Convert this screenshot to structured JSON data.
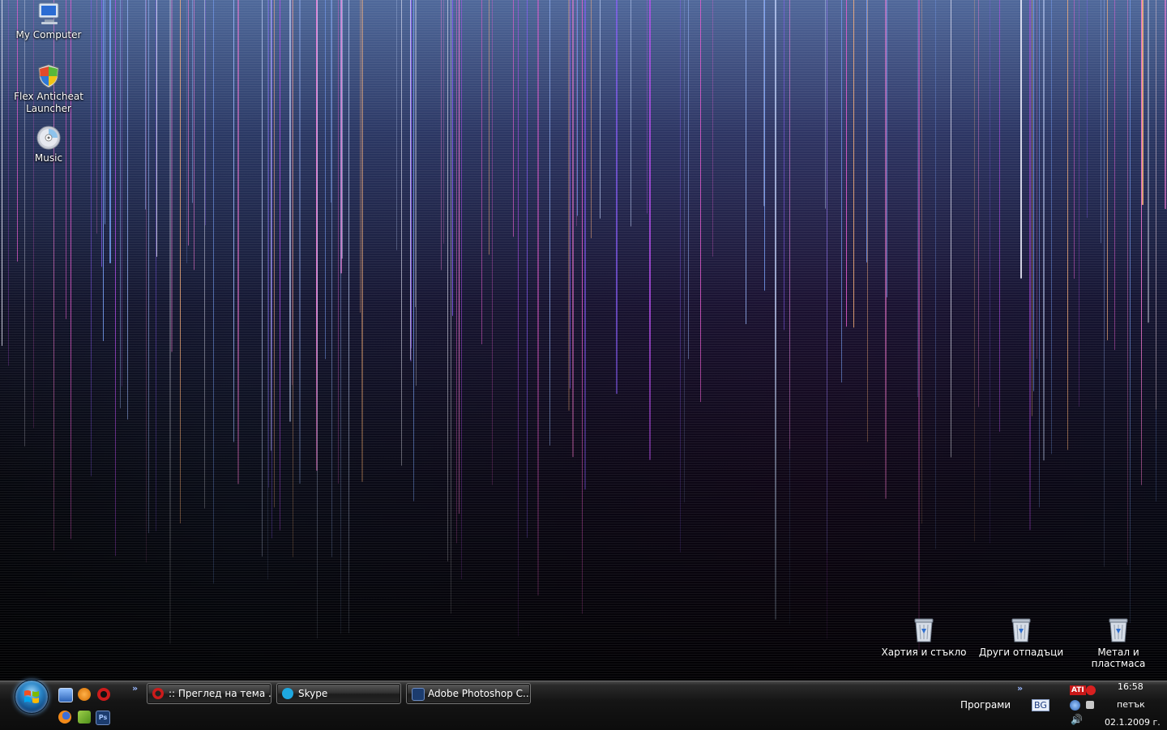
{
  "desktop": {
    "icons": [
      {
        "label_line1": "My Computer",
        "label_line2": "",
        "icon": "my-computer-icon"
      },
      {
        "label_line1": "Flex Anticheat",
        "label_line2": "Launcher",
        "icon": "shield-icon"
      },
      {
        "label_line1": "Music",
        "label_line2": "",
        "icon": "cd-icon"
      }
    ],
    "bins": [
      {
        "label": "Хартия и стъкло",
        "icon": "recycle-bin-icon"
      },
      {
        "label": "Други отпадъци",
        "icon": "recycle-bin-icon"
      },
      {
        "label": "Метал и пластмаса",
        "icon": "recycle-bin-icon"
      }
    ]
  },
  "taskbar": {
    "quicklaunch_chevron": "»",
    "tasks": [
      {
        "label": ":: Преглед на тема ...",
        "icon": "opera-icon"
      },
      {
        "label": "Skype",
        "icon": "skype-icon"
      },
      {
        "label": "Adobe Photoshop C...",
        "icon": "photoshop-icon"
      }
    ],
    "toolbar_chevron": "»",
    "programs_label": "Програми",
    "language": "BG",
    "ati_label": "ATI",
    "ps_label": "Ps",
    "clock": {
      "time": "16:58",
      "day": "петък",
      "date": "02.1.2009 г."
    }
  },
  "colors": {
    "taskbar_bg": "#151515",
    "accent_blue": "#2a86c8",
    "opera_red": "#cc1b1b",
    "skype_blue": "#1ea8e0",
    "photoshop_blue": "#1c3c6e"
  }
}
